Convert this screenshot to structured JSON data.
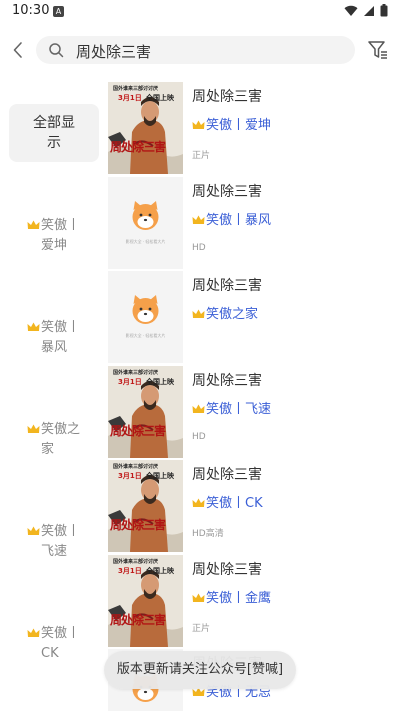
{
  "status_bar": {
    "time": "10:30",
    "notification_letter": "A"
  },
  "search": {
    "query": "周处除三害"
  },
  "categories": [
    {
      "label": "全部显示"
    },
    {
      "label": "笑傲丨爱坤"
    },
    {
      "label": "笑傲丨暴风"
    },
    {
      "label": "笑傲之家"
    },
    {
      "label": "笑傲丨飞速"
    },
    {
      "label": "笑傲丨CK"
    }
  ],
  "results": [
    {
      "title": "周处除三害",
      "source": "笑傲丨爱坤",
      "quality": "正片",
      "poster": "movie"
    },
    {
      "title": "周处除三害",
      "source": "笑傲丨暴风",
      "quality": "HD",
      "poster": "placeholder"
    },
    {
      "title": "周处除三害",
      "source": "笑傲之家",
      "quality": "",
      "poster": "placeholder"
    },
    {
      "title": "周处除三害",
      "source": "笑傲丨飞速",
      "quality": "HD",
      "poster": "movie"
    },
    {
      "title": "周处除三害",
      "source": "笑傲丨CK",
      "quality": "HD高清",
      "poster": "movie"
    },
    {
      "title": "周处除三害",
      "source": "笑傲丨金鹰",
      "quality": "正片",
      "poster": "movie"
    },
    {
      "title": "周处除三害",
      "source": "笑傲丨无忌",
      "quality": "",
      "poster": "placeholder"
    }
  ],
  "poster_text": {
    "release_line": "国外谁来三部讨讨厌",
    "date": "3月1日",
    "tagline": "全国上映",
    "calligraphy": "周处除三害"
  },
  "placeholder_caption": "影视大全 · 轻松看大片",
  "toast": {
    "message": "版本更新请关注公众号[赞喊]"
  },
  "colors": {
    "accent_blue": "#3b5fd6",
    "crown_gold": "#f2b51f",
    "shiba_orange": "#f5a04a"
  }
}
